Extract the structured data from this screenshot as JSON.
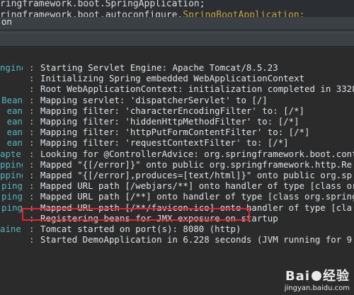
{
  "editor": {
    "line1": "ringframework.boot.SpringApplication;",
    "line2_prefix": "ringframework.boot.autoconfigure.",
    "line2_highlight": "SpringBootApplication;"
  },
  "console": {
    "title": "on"
  },
  "log_rows": [
    {
      "src": "ngine",
      "msg": "Starting Servlet Engine: Apache Tomcat/8.5.23"
    },
    {
      "src": "",
      "msg": "Initializing Spring embedded WebApplicationContext"
    },
    {
      "src": "",
      "msg": "Root WebApplicationContext: initialization completed in 3328"
    },
    {
      "src": "Bean",
      "msg": "Mapping servlet: 'dispatcherServlet' to [/]"
    },
    {
      "src": "ean",
      "msg": "Mapping filter: 'characterEncodingFilter' to: [/*]"
    },
    {
      "src": "ean",
      "msg": "Mapping filter: 'hiddenHttpMethodFilter' to: [/*]"
    },
    {
      "src": "ean",
      "msg": "Mapping filter: 'httpPutFormContentFilter' to: [/*]"
    },
    {
      "src": "ean",
      "msg": "Mapping filter: 'requestContextFilter' to: [/*]"
    },
    {
      "src": "apter",
      "msg": "Looking for @ControllerAdvice: org.springframework.boot.cont"
    },
    {
      "src": "pping",
      "msg": "Mapped \"{[/error]}\" onto public org.springframework.http.Re"
    },
    {
      "src": "pping",
      "msg": "Mapped \"{[/error],produces=[text/html]}\" onto public org.sp"
    },
    {
      "src": "ping",
      "msg": "Mapped URL path [/webjars/**] onto handler of type [class or"
    },
    {
      "src": "ping",
      "msg": "Mapped URL path [/**] onto handler of type [class org.spring"
    },
    {
      "src": "ping",
      "msg": "Mapped URL path [/**/favicon.ico] onto handler of type [cla"
    },
    {
      "src": "",
      "msg": "Registering beans for JMX exposure on startup"
    },
    {
      "src": "ainer",
      "msg": "Tomcat started on port(s): 8080 (http)"
    },
    {
      "src": "",
      "msg": "Started DemoApplication in 6.228 seconds (JVM running for 9"
    }
  ],
  "separator": ":",
  "watermark": {
    "brand_left": "Bai",
    "brand_right": "经验",
    "url": "jingyan.baidu.com"
  }
}
